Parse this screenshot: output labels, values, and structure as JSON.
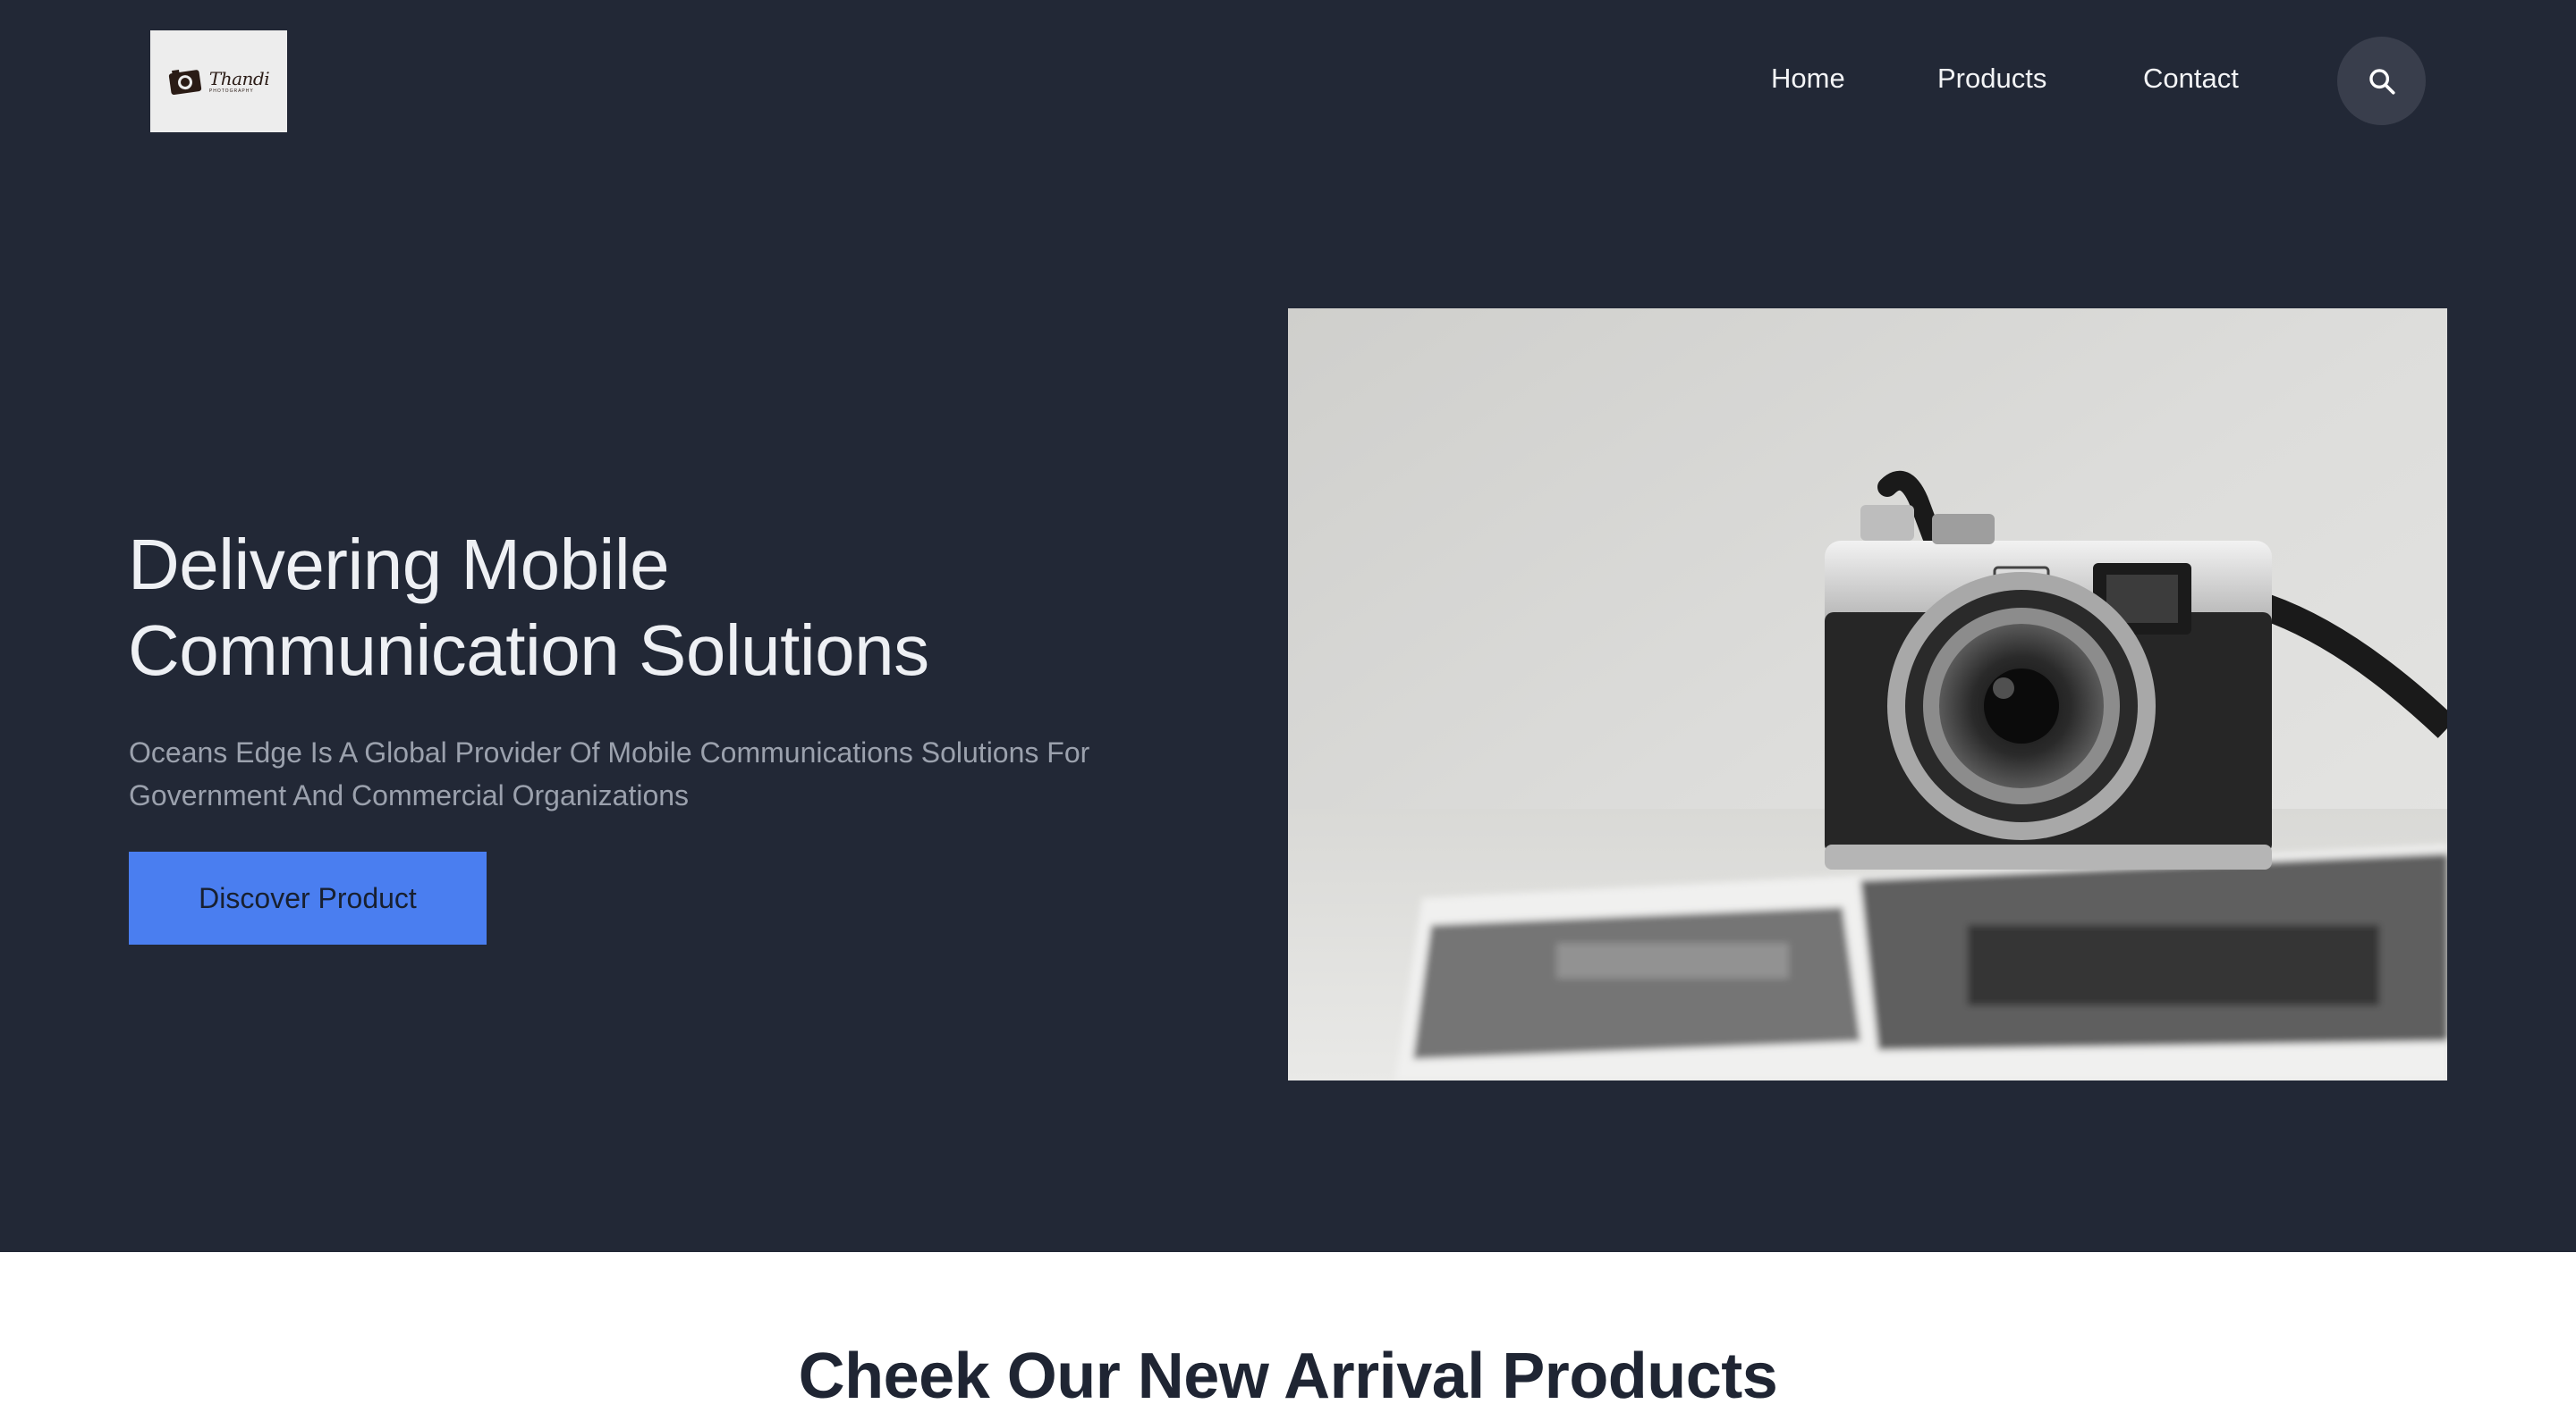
{
  "brand": {
    "logo_word": "Thandi",
    "logo_subtitle": "PHOTOGRAPHY"
  },
  "nav": {
    "items": [
      {
        "label": "Home"
      },
      {
        "label": "Products"
      },
      {
        "label": "Contact"
      }
    ],
    "search_icon": "search-icon"
  },
  "hero": {
    "title": "Delivering Mobile Communication Solutions",
    "subtitle": "Oceans Edge Is A Global Provider Of Mobile Communications Solutions For Government And Commercial Organizations",
    "cta_label": "Discover Product",
    "image_subject": "camera-photo"
  },
  "section": {
    "title": "Cheek Our New Arrival Products"
  },
  "colors": {
    "background_dark": "#222836",
    "accent": "#4a7ef0",
    "search_button": "#393e4c"
  }
}
